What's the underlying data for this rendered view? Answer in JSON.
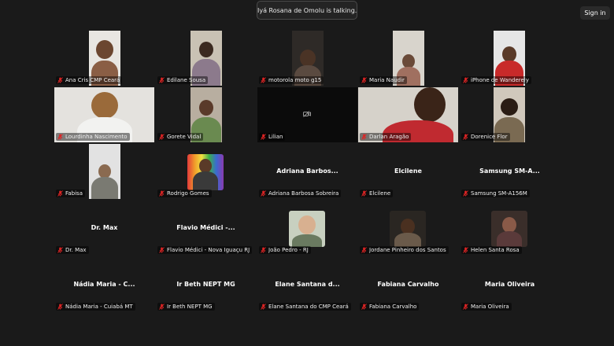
{
  "banner": {
    "text": "Iyá Rosana de Omolu is talking..."
  },
  "header": {
    "sign_in_label": "Sign in"
  },
  "icons": {
    "mic": "mic-muted-icon",
    "camera": "camera-off-icon"
  },
  "colors": {
    "mic_muted": "#e02424",
    "background": "#1a1a1a"
  },
  "participants": [
    {
      "name": "Ana Cris CMP Ceará"
    },
    {
      "name": "Edilane Sousa"
    },
    {
      "name": "motorola moto g15"
    },
    {
      "name": "Maria Naudir"
    },
    {
      "name": "iPhone de Wanderely"
    },
    {
      "name": "Lourdinha Nascimento"
    },
    {
      "name": "Gorete Vidal"
    },
    {
      "name": "Lilian"
    },
    {
      "name": "Darlan Aragão"
    },
    {
      "name": "Dorenice Flor"
    },
    {
      "name": "Fabisa"
    },
    {
      "name": "Rodrigo Gomes"
    },
    {
      "name": "Adriana Barbosa Sobreira",
      "display_name": "Adriana Barbos..."
    },
    {
      "name": "Elcilene",
      "display_name": "Elcilene"
    },
    {
      "name": "Samsung SM-A156M",
      "display_name": "Samsung SM-A..."
    },
    {
      "name": "Dr. Max",
      "display_name": "Dr. Max"
    },
    {
      "name": "Flavio Médici - Nova Iguaçu RJ",
      "display_name": "Flavio Médici -..."
    },
    {
      "name": "João Pedro - RJ"
    },
    {
      "name": "Jordane Pinheiro dos Santos"
    },
    {
      "name": "Helen Santa Rosa"
    },
    {
      "name": "Nádia Maria - Cuiabá MT",
      "display_name": "Nádia Maria - C..."
    },
    {
      "name": "Ir Beth NEPT MG",
      "display_name": "Ir Beth NEPT MG"
    },
    {
      "name": "Elane Santana do CMP Ceará",
      "display_name": "Elane Santana d..."
    },
    {
      "name": "Fabiana Carvalho",
      "display_name": "Fabiana Carvalho"
    },
    {
      "name": "Maria Oliveira",
      "display_name": "Maria Oliveira"
    }
  ]
}
